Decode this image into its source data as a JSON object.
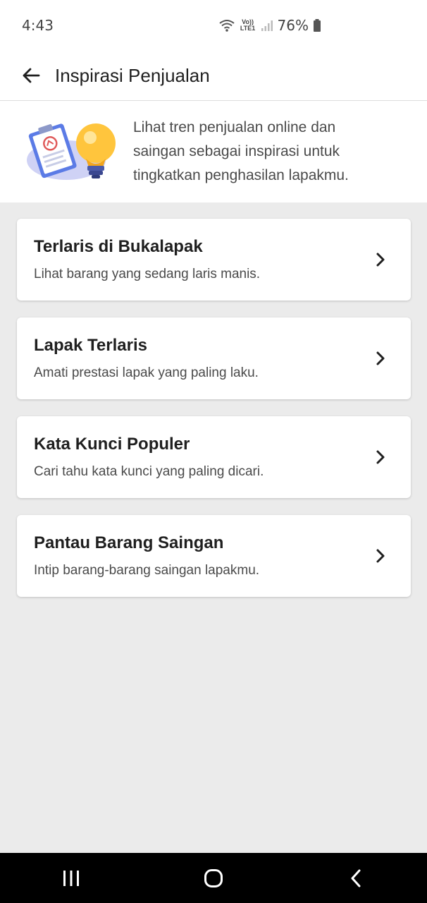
{
  "status_bar": {
    "time": "4:43",
    "network_label": "Vo)) LTE1",
    "battery_percent": "76%"
  },
  "header": {
    "title": "Inspirasi Penjualan"
  },
  "intro": {
    "description": "Lihat tren penjualan online dan saingan sebagai inspirasi untuk tingkatkan penghasilan lapakmu."
  },
  "menu": {
    "items": [
      {
        "title": "Terlaris di Bukalapak",
        "subtitle": "Lihat barang yang sedang laris manis."
      },
      {
        "title": "Lapak Terlaris",
        "subtitle": "Amati prestasi lapak yang paling laku."
      },
      {
        "title": "Kata Kunci Populer",
        "subtitle": "Cari tahu kata kunci yang paling dicari."
      },
      {
        "title": "Pantau Barang Saingan",
        "subtitle": "Intip barang-barang saingan lapakmu."
      }
    ]
  },
  "icons": {
    "back": "arrow-left-icon",
    "chevron": "chevron-right-icon",
    "nav_recents": "recents-icon",
    "nav_home": "home-icon",
    "nav_back": "nav-back-icon"
  },
  "colors": {
    "background": "#ebebeb",
    "card": "#ffffff",
    "text_primary": "#1f1f1f",
    "text_secondary": "#4a4a4a"
  }
}
